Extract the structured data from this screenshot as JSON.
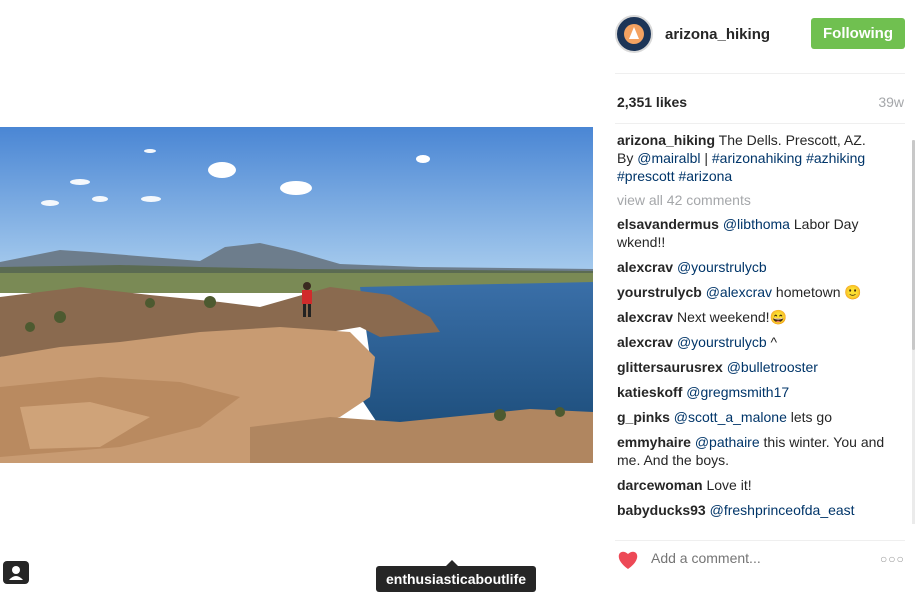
{
  "post": {
    "username": "arizona_hiking",
    "follow_label": "Following",
    "likes": "2,351 likes",
    "time": "39w",
    "caption": {
      "user": "arizona_hiking",
      "text_1": " The Dells. Prescott, AZ.",
      "text_2": "By ",
      "mention": "@mairalbl",
      "sep": " | ",
      "tags": "#arizonahiking #azhiking #prescott #arizona"
    },
    "view_all": "view all 42 comments",
    "comments": [
      {
        "user": "elsavandermus",
        "mention": "@libthoma",
        "text": " Labor Day wkend!!"
      },
      {
        "user": "alexcrav",
        "mention": "@yourstrulycb",
        "text": ""
      },
      {
        "user": "yourstrulycb",
        "mention": "@alexcrav",
        "text": " hometown 🙂"
      },
      {
        "user": "alexcrav",
        "mention": "",
        "text": " Next weekend!😄"
      },
      {
        "user": "alexcrav",
        "mention": "@yourstrulycb",
        "text": " ^"
      },
      {
        "user": "glittersaurusrex",
        "mention": "@bulletrooster",
        "text": ""
      },
      {
        "user": "katieskoff",
        "mention": "@gregmsmith17",
        "text": ""
      },
      {
        "user": "g_pinks",
        "mention": "@scott_a_malone",
        "text": " lets go"
      },
      {
        "user": "emmyhaire",
        "mention": "@pathaire",
        "text": " this winter. You and me. And the boys."
      },
      {
        "user": "darcewoman",
        "mention": "",
        "text": " Love it!"
      },
      {
        "user": "babyducks93",
        "mention": "@freshprinceofda_east",
        "text": ""
      }
    ],
    "comment_placeholder": "Add a comment...",
    "more_label": "○○○",
    "tag_tooltip": "enthusiasticaboutlife"
  },
  "colors": {
    "follow_green": "#70c050",
    "link_blue": "#003569",
    "heart_red": "#ed4956"
  },
  "icons": {
    "avatar": "arizona-hiking-logo",
    "like": "heart-icon",
    "user_tag": "user-tag-icon",
    "more": "more-options-icon"
  }
}
